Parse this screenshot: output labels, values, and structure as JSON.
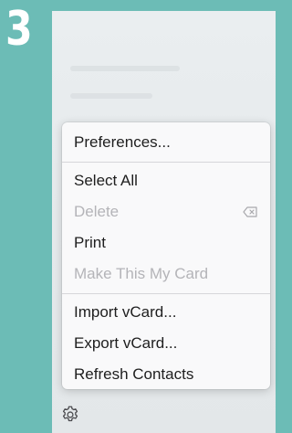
{
  "step_number": "3",
  "menu": {
    "items": [
      {
        "label": "Preferences...",
        "enabled": true
      },
      {
        "label": "Select All",
        "enabled": true
      },
      {
        "label": "Delete",
        "enabled": false,
        "shortcut_icon": "delete-key-icon"
      },
      {
        "label": "Print",
        "enabled": true
      },
      {
        "label": "Make This My Card",
        "enabled": false
      },
      {
        "label": "Import vCard...",
        "enabled": true
      },
      {
        "label": "Export vCard...",
        "enabled": true
      },
      {
        "label": "Refresh Contacts",
        "enabled": true
      }
    ]
  },
  "footer": {
    "icon": "gear-icon"
  },
  "colors": {
    "frame": "#6cbcb6",
    "menu_bg": "#f9f9fa",
    "disabled_text": "#b4b4b8"
  }
}
